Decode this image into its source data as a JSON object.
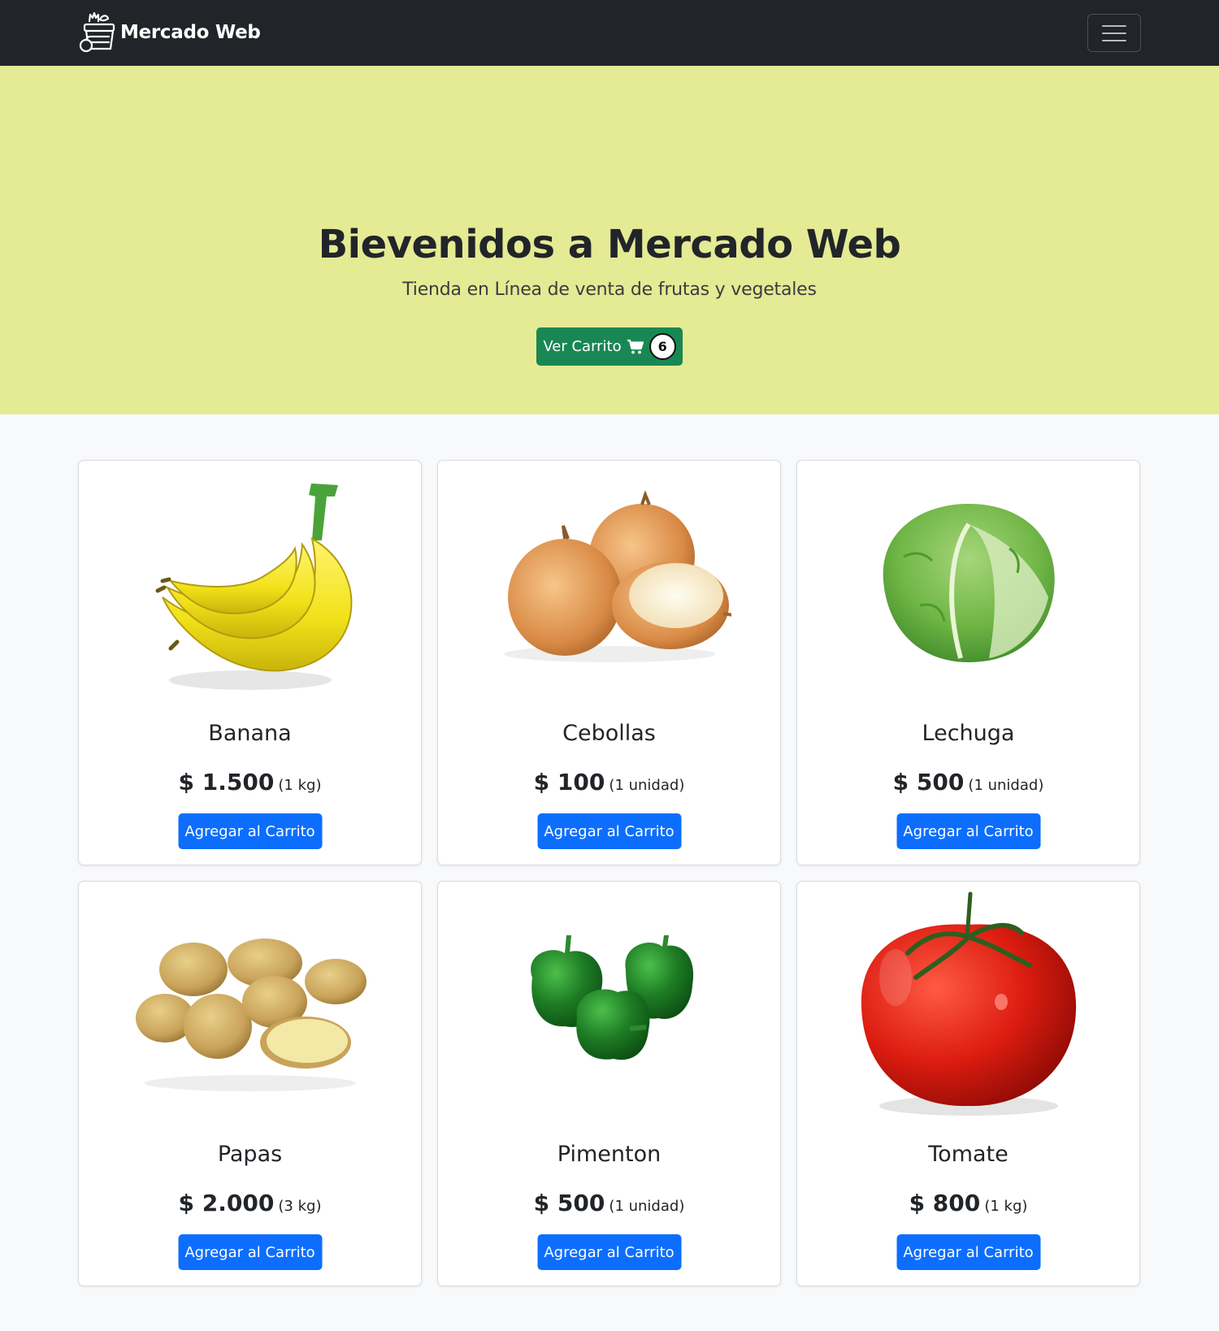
{
  "navbar": {
    "brand_name": "Mercado Web",
    "logo_icon": "basket-logo-icon",
    "toggler_icon": "hamburger-menu-icon"
  },
  "hero": {
    "title": "Bievenidos a Mercado Web",
    "subtitle": "Tienda en Línea de venta de frutas y vegetales",
    "cart_button_label": "Ver Carrito",
    "cart_icon": "shopping-cart-icon",
    "cart_count": "6"
  },
  "products": [
    {
      "name": "Banana",
      "price": "$ 1.500",
      "unit": "(1 kg)",
      "button_label": "Agregar al Carrito",
      "image_icon": "banana-image"
    },
    {
      "name": "Cebollas",
      "price": "$ 100",
      "unit": "(1 unidad)",
      "button_label": "Agregar al Carrito",
      "image_icon": "onion-image"
    },
    {
      "name": "Lechuga",
      "price": "$ 500",
      "unit": "(1 unidad)",
      "button_label": "Agregar al Carrito",
      "image_icon": "lettuce-image"
    },
    {
      "name": "Papas",
      "price": "$ 2.000",
      "unit": "(3 kg)",
      "button_label": "Agregar al Carrito",
      "image_icon": "potato-image"
    },
    {
      "name": "Pimenton",
      "price": "$ 500",
      "unit": "(1 unidad)",
      "button_label": "Agregar al Carrito",
      "image_icon": "pepper-image"
    },
    {
      "name": "Tomate",
      "price": "$ 800",
      "unit": "(1 kg)",
      "button_label": "Agregar al Carrito",
      "image_icon": "tomato-image"
    }
  ],
  "colors": {
    "navbar_bg": "#212529",
    "hero_bg": "#e5ea94",
    "cart_button": "#198754",
    "add_button": "#0d6efd",
    "page_bg": "#f8f9fa"
  }
}
